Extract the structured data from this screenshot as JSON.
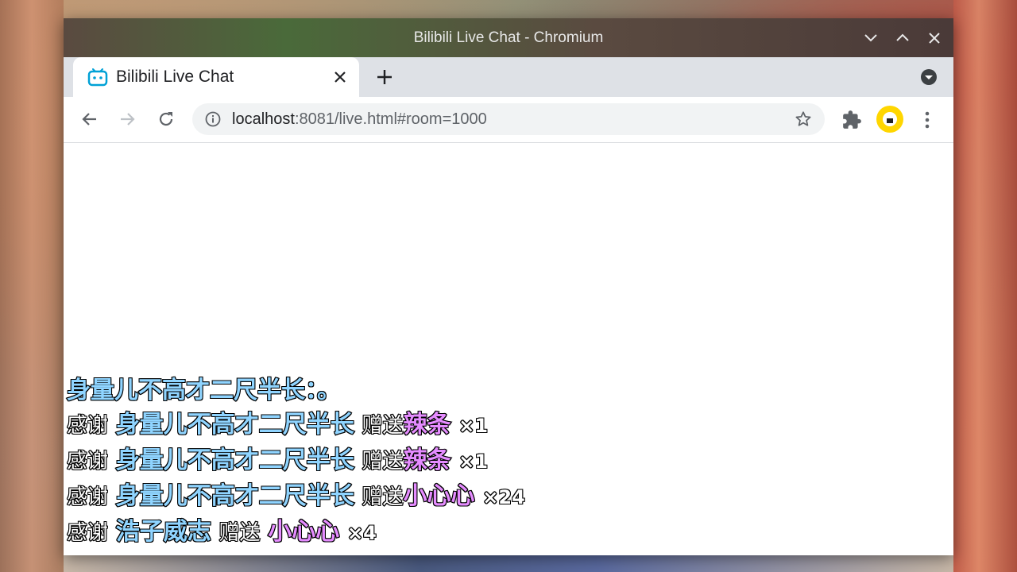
{
  "window": {
    "title": "Bilibili Live Chat - Chromium"
  },
  "tab": {
    "label": "Bilibili Live Chat",
    "favicon": "bilibili-tv-icon"
  },
  "omnibox": {
    "url_host": "localhost",
    "url_rest": ":8081/live.html#room=1000"
  },
  "chat": {
    "message": {
      "text": "身量儿不高才二尺半长：。"
    },
    "gifts": [
      {
        "thanks": "感谢",
        "user": "身量儿不高才二尺半长",
        "verb": "赠送",
        "gift": "辣条",
        "count": "×1"
      },
      {
        "thanks": "感谢",
        "user": "身量儿不高才二尺半长",
        "verb": "赠送",
        "gift": "辣条",
        "count": "×1"
      },
      {
        "thanks": "感谢",
        "user": "身量儿不高才二尺半长",
        "verb": "赠送",
        "gift": "小心心",
        "count": "×24"
      },
      {
        "thanks": "感谢",
        "user": "浩子威志",
        "verb": "赠送",
        "gift": "小心心",
        "count": "×4"
      }
    ]
  },
  "colors": {
    "username": "#8fd4ff",
    "gift_name": "#e58cff",
    "profile_avatar": "#ffd600",
    "favicon": "#00a1d6"
  }
}
